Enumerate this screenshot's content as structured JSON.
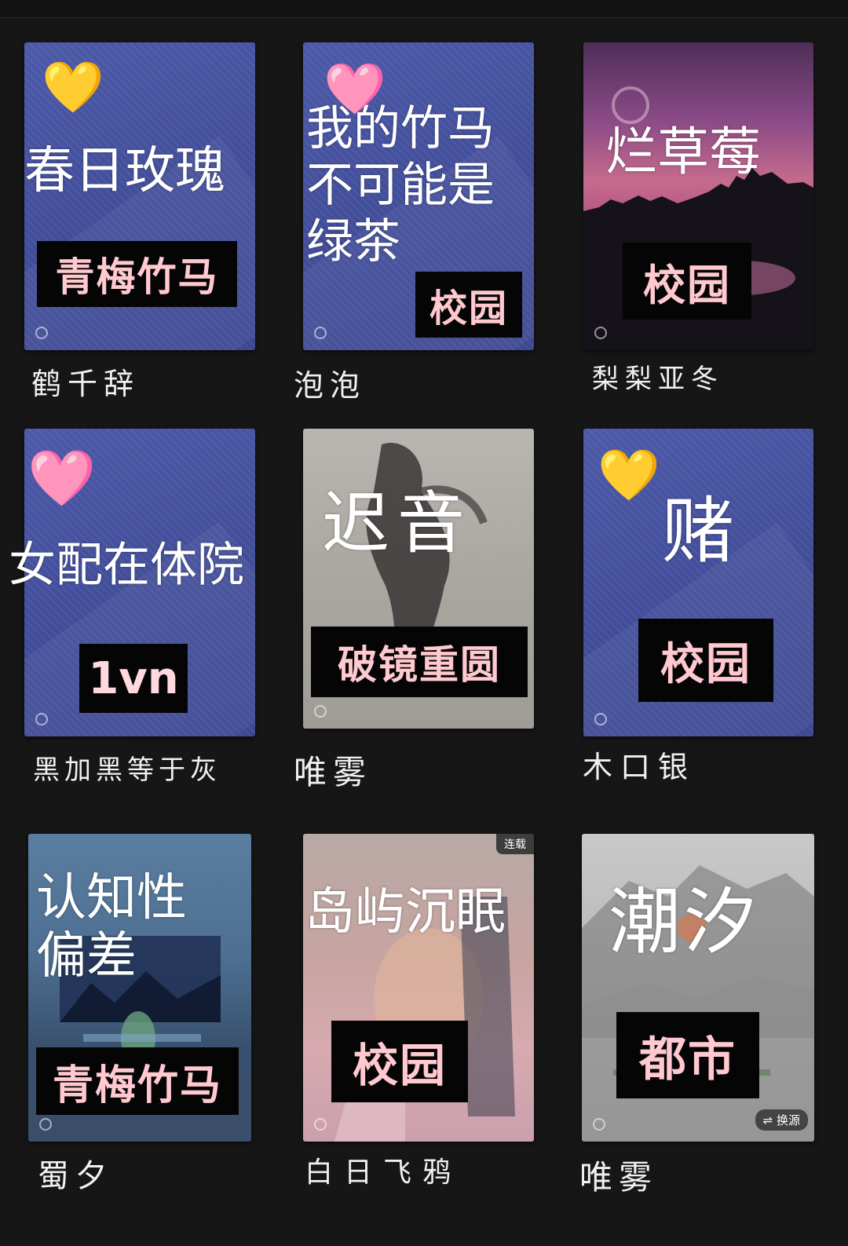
{
  "books": [
    {
      "title": "春日玫瑰",
      "tag": "青梅竹马",
      "author": "鹤千辞",
      "heart": "💛",
      "link_icon": "link-icon"
    },
    {
      "title": "我的竹马\n不可能是\n绿茶",
      "tag": "校园",
      "author": "泡泡",
      "heart": "🩷",
      "link_icon": "link-icon"
    },
    {
      "title": "烂草莓",
      "tag": "校园",
      "author": "梨梨亚冬",
      "link_icon": "link-icon"
    },
    {
      "title": "女配在体院",
      "tag": "1vn",
      "author": "黑加黑等于灰",
      "heart": "🩷",
      "link_icon": "link-icon"
    },
    {
      "title": "迟音",
      "tag": "破镜重圆",
      "author": "唯雾",
      "link_icon": "link-icon"
    },
    {
      "title": "赌",
      "tag": "校园",
      "author": "木口银",
      "heart": "💛",
      "link_icon": "link-icon"
    },
    {
      "title": "认知性\n偏差",
      "tag": "青梅竹马",
      "author": "蜀夕",
      "link_icon": "link-icon"
    },
    {
      "title": "岛屿沉眠",
      "tag": "校园",
      "author": "白日飞鸦",
      "badge": "连载",
      "link_icon": "link-icon"
    },
    {
      "title": "潮汐",
      "tag": "都市",
      "author": "唯雾",
      "swap": "⇌ 换源",
      "link_icon": "link-icon"
    }
  ]
}
